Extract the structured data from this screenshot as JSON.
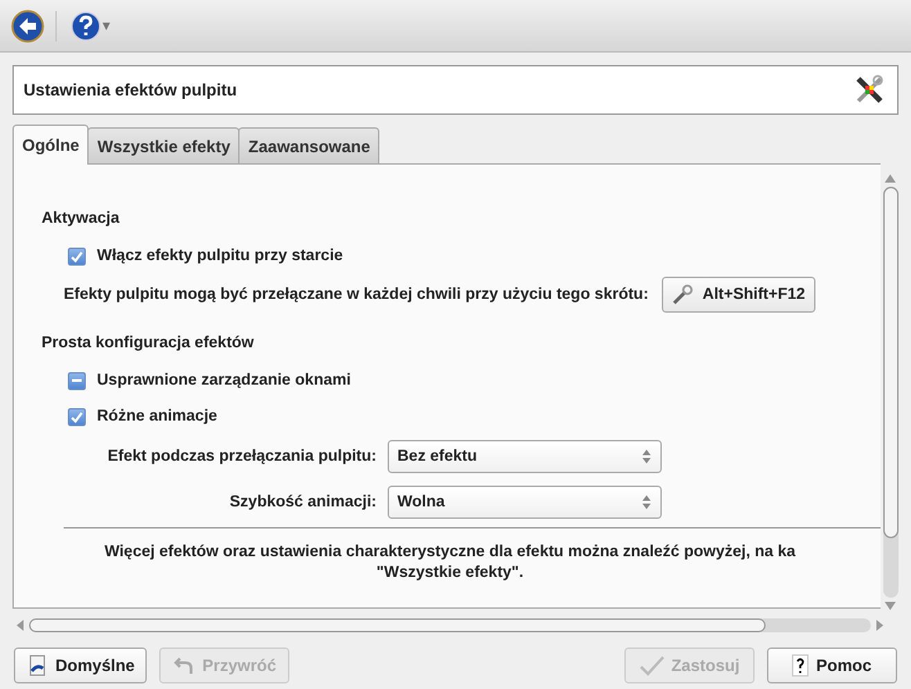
{
  "toolbar": {
    "menu_arrow": "▾"
  },
  "header": {
    "title": "Ustawienia efektów pulpitu"
  },
  "tabs": [
    {
      "label": "Ogólne",
      "selected": true
    },
    {
      "label": "Wszystkie efekty",
      "selected": false
    },
    {
      "label": "Zaawansowane",
      "selected": false
    }
  ],
  "activation": {
    "heading": "Aktywacja",
    "checkboxes": [
      {
        "label": "Włącz efekty pulpitu przy starcie",
        "kind": "checkbox",
        "checked": true
      }
    ],
    "shortcut_label": "Efekty pulpitu mogą być przełączane w każdej chwili przy użyciu tego skrótu:",
    "shortcut_button": "Alt+Shift+F12"
  },
  "simple_config": {
    "heading": "Prosta konfiguracja efektów",
    "checkboxes": [
      {
        "label": "Usprawnione zarządzanie oknami",
        "kind": "tristate",
        "checked": true
      },
      {
        "label": "Różne animacje",
        "kind": "checkbox",
        "checked": true
      }
    ],
    "combos": [
      {
        "label": "Efekt podczas przełączania pulpitu:",
        "value": "Bez efektu"
      },
      {
        "label": "Szybkość animacji:",
        "value": "Wolna"
      }
    ],
    "note_lines": [
      "Więcej efektów oraz ustawienia charakterystyczne dla efektu można znaleźć powyżej, na ka",
      "\"Wszystkie efekty\"."
    ]
  },
  "buttons": [
    {
      "label": "Domyślne",
      "kind": "defaults",
      "disabled": false
    },
    {
      "label": "Przywróć",
      "kind": "reset",
      "disabled": true
    },
    {
      "label": "Zastosuj",
      "kind": "apply",
      "disabled": true
    },
    {
      "label": "Pomoc",
      "kind": "help",
      "disabled": false
    }
  ]
}
